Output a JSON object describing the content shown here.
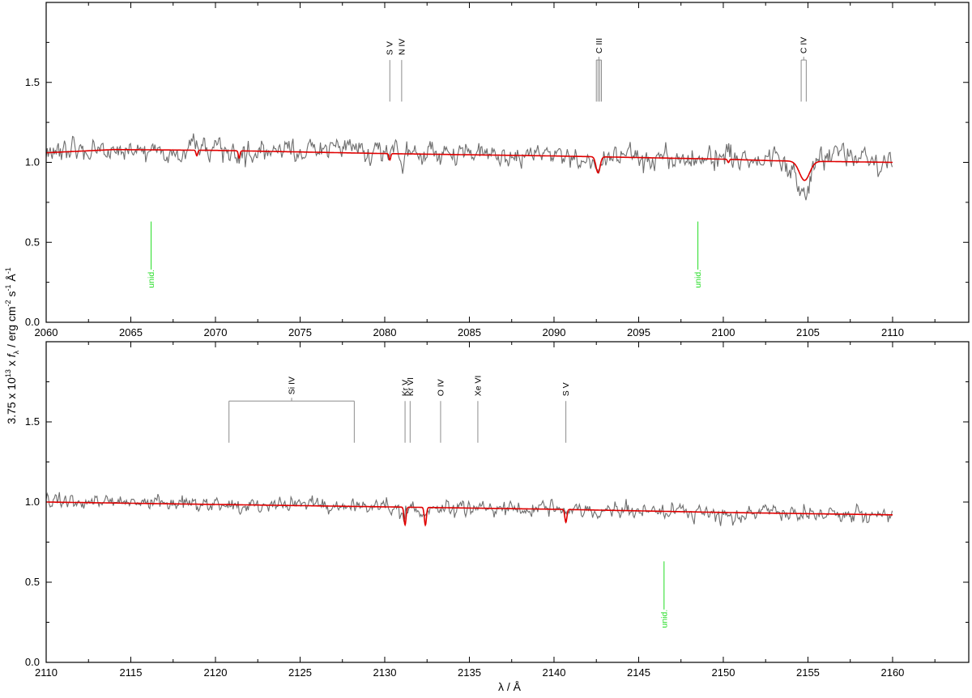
{
  "y_axis_label": {
    "prefix": "3.75 x 10",
    "prefix_exp": "13",
    "x": " x ",
    "f": "f",
    "f_sub": "λ",
    "unit": " / erg cm",
    "cm_exp": "-2",
    "s": " s",
    "s_exp": "-1",
    "angstrom": " Å",
    "a_exp": "-1"
  },
  "x_axis_label": "λ / Å",
  "colors": {
    "observation": "#6e6e6e",
    "model": "#e00000",
    "line_ids": "#8c8c8c",
    "unidentified": "#22dd22",
    "frame": "#000000"
  },
  "chart_data": [
    {
      "type": "line",
      "panel": "top",
      "xlim": [
        2060,
        2114.5
      ],
      "ylim": [
        0.0,
        2.0
      ],
      "xticks": [
        2060,
        2065,
        2070,
        2075,
        2080,
        2085,
        2090,
        2095,
        2100,
        2105,
        2110
      ],
      "yticks": [
        0.0,
        0.5,
        1.0,
        1.5
      ],
      "xtick_labels": [
        "2060",
        "2065",
        "2070",
        "2075",
        "2080",
        "2085",
        "2090",
        "2095",
        "2100",
        "2105",
        "2110"
      ],
      "ytick_labels": [
        "0.0",
        "0.5",
        "1.0",
        "1.5"
      ],
      "series": [
        {
          "role": "observation",
          "x_range": [
            2060,
            2110
          ],
          "noise_sigma": 0.045,
          "features": [
            {
              "x": 2092.6,
              "depth": 0.08,
              "width": 0.22
            },
            {
              "x": 2104.7,
              "depth": 0.19,
              "width": 0.35
            },
            {
              "x": 2077.8,
              "depth": -0.06,
              "width": 0.5
            },
            {
              "x": 2106.9,
              "depth": -0.07,
              "width": 0.5
            }
          ]
        },
        {
          "role": "model",
          "x_range": [
            2060,
            2110
          ],
          "continuum_points": [
            [
              2060,
              1.06
            ],
            [
              2064,
              1.08
            ],
            [
              2070,
              1.075
            ],
            [
              2080,
              1.055
            ],
            [
              2090,
              1.04
            ],
            [
              2100,
              1.02
            ],
            [
              2103,
              1.01
            ],
            [
              2110,
              1.0
            ]
          ],
          "features": [
            {
              "x": 2068.9,
              "depth": 0.035,
              "width": 0.05
            },
            {
              "x": 2071.4,
              "depth": 0.045,
              "width": 0.05
            },
            {
              "x": 2080.3,
              "depth": 0.04,
              "width": 0.05
            },
            {
              "x": 2092.6,
              "depth": 0.1,
              "width": 0.12
            },
            {
              "x": 2100.3,
              "depth": 0.02,
              "width": 0.05
            },
            {
              "x": 2104.8,
              "depth": 0.12,
              "width": 0.3
            }
          ]
        }
      ],
      "line_ids": [
        {
          "label": "S V",
          "x": [
            2080.3
          ],
          "y_top": 1.64,
          "y_bottom": 1.38
        },
        {
          "label": "N IV",
          "x": [
            2081.0
          ],
          "y_top": 1.64,
          "y_bottom": 1.38
        },
        {
          "label": "C III",
          "x": [
            2092.5,
            2092.6,
            2092.7,
            2092.8
          ],
          "y_top": 1.64,
          "y_bottom": 1.38
        },
        {
          "label": "C IV",
          "x": [
            2104.6,
            2104.9
          ],
          "y_top": 1.64,
          "y_bottom": 1.38
        }
      ],
      "unidentified": [
        {
          "label": "unid.",
          "x": 2066.2,
          "y_top": 0.63,
          "y_bottom": 0.36
        },
        {
          "label": "unid.",
          "x": 2098.5,
          "y_top": 0.63,
          "y_bottom": 0.36
        }
      ]
    },
    {
      "type": "line",
      "panel": "bottom",
      "xlim": [
        2110,
        2164.5
      ],
      "ylim": [
        0.0,
        2.0
      ],
      "xticks": [
        2110,
        2115,
        2120,
        2125,
        2130,
        2135,
        2140,
        2145,
        2150,
        2155,
        2160
      ],
      "yticks": [
        0.0,
        0.5,
        1.0,
        1.5
      ],
      "xtick_labels": [
        "2110",
        "2115",
        "2120",
        "2125",
        "2130",
        "2135",
        "2140",
        "2145",
        "2150",
        "2155",
        "2160"
      ],
      "ytick_labels": [
        "0.0",
        "0.5",
        "1.0",
        "1.5"
      ],
      "series": [
        {
          "role": "observation",
          "x_range": [
            2110,
            2160
          ],
          "noise_sigma": 0.03,
          "features": [
            {
              "x": 2131.2,
              "depth": 0.05,
              "width": 0.2
            },
            {
              "x": 2132.4,
              "depth": 0.05,
              "width": 0.2
            },
            {
              "x": 2146.5,
              "depth": 0.04,
              "width": 0.25
            }
          ]
        },
        {
          "role": "model",
          "x_range": [
            2110,
            2160
          ],
          "continuum_points": [
            [
              2110,
              1.0
            ],
            [
              2120,
              0.985
            ],
            [
              2130,
              0.97
            ],
            [
              2140,
              0.955
            ],
            [
              2150,
              0.935
            ],
            [
              2160,
              0.92
            ]
          ],
          "features": [
            {
              "x": 2131.2,
              "depth": 0.11,
              "width": 0.06
            },
            {
              "x": 2132.4,
              "depth": 0.11,
              "width": 0.06
            },
            {
              "x": 2140.7,
              "depth": 0.08,
              "width": 0.06
            }
          ]
        }
      ],
      "line_ids": [
        {
          "label": "Si IV",
          "x": [
            2120.8,
            2128.2
          ],
          "y_top": 1.63,
          "y_bottom": 1.37
        },
        {
          "label": "Kr V",
          "x": [
            2131.2
          ],
          "y_top": 1.63,
          "y_bottom": 1.37
        },
        {
          "label": "Kr VI",
          "x": [
            2131.5
          ],
          "y_top": 1.63,
          "y_bottom": 1.37
        },
        {
          "label": "O IV",
          "x": [
            2133.3
          ],
          "y_top": 1.63,
          "y_bottom": 1.37
        },
        {
          "label": "Xe VI",
          "x": [
            2135.5
          ],
          "y_top": 1.63,
          "y_bottom": 1.37
        },
        {
          "label": "S V",
          "x": [
            2140.7
          ],
          "y_top": 1.63,
          "y_bottom": 1.37
        }
      ],
      "unidentified": [
        {
          "label": "unid.",
          "x": 2146.5,
          "y_top": 0.63,
          "y_bottom": 0.36
        }
      ]
    }
  ]
}
